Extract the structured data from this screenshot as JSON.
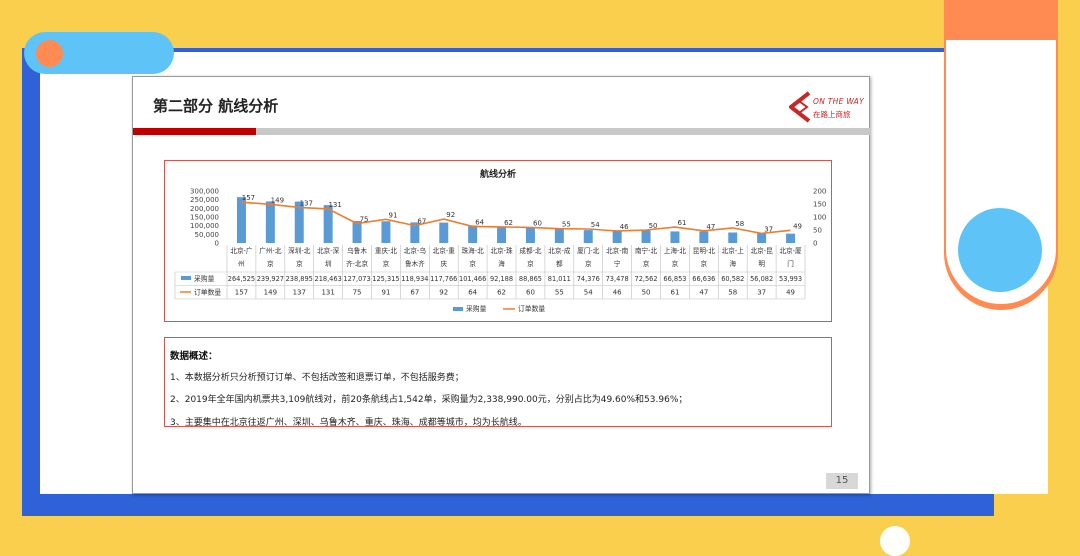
{
  "slide": {
    "title": "第二部分  航线分析",
    "logo_text": "ON THE WAY",
    "logo_subtext": "在路上商旅",
    "page_number": "15"
  },
  "summary": {
    "heading": "数据概述：",
    "lines": [
      "1、本数据分析只分析预订订单、不包括改签和退票订单，不包括服务费；",
      "2、2019年全年国内机票共3,109航线对，前20条航线占1,542单，采购量为2,338,990.00元，分别占比为49.60%和53.96%；",
      "3、主要集中在北京往返广州、深圳、乌鲁木齐、重庆、珠海、成都等城市，均为长航线。"
    ]
  },
  "colors": {
    "bar": "#5b9bd5",
    "line": "#ed7d31",
    "accent_red": "#c00000",
    "frame_blue": "#2f62d9",
    "background_yellow": "#f9cf4d",
    "decor_orange": "#ff8a52",
    "decor_cyan": "#5ec4f8"
  },
  "chart_data": {
    "type": "bar",
    "title": "航线分析",
    "categories": [
      [
        "北京-广",
        "州"
      ],
      [
        "广州-北",
        "京"
      ],
      [
        "深圳-北",
        "京"
      ],
      [
        "北京-深",
        "圳"
      ],
      [
        "乌鲁木",
        "齐-北京"
      ],
      [
        "重庆-北",
        "京"
      ],
      [
        "北京-乌",
        "鲁木齐"
      ],
      [
        "北京-重",
        "庆"
      ],
      [
        "珠海-北",
        "京"
      ],
      [
        "北京-珠",
        "海"
      ],
      [
        "成都-北",
        "京"
      ],
      [
        "北京-成",
        "都"
      ],
      [
        "厦门-北",
        "京"
      ],
      [
        "北京-南",
        "宁"
      ],
      [
        "南宁-北",
        "京"
      ],
      [
        "上海-北",
        "京"
      ],
      [
        "昆明-北",
        "京"
      ],
      [
        "北京-上",
        "海"
      ],
      [
        "北京-昆",
        "明"
      ],
      [
        "北京-厦",
        "门"
      ]
    ],
    "series": [
      {
        "name": "采购量",
        "type": "bar",
        "axis": "left",
        "values": [
          264525,
          239927,
          238895,
          218463,
          127073,
          125315,
          118934,
          117766,
          101466,
          92188,
          88865,
          81011,
          74376,
          73478,
          72562,
          66853,
          66636,
          60582,
          56082,
          53993
        ],
        "table_labels": [
          "264,525",
          "239,927",
          "238,895",
          "218,463",
          "127,073",
          "125,315",
          "118,934",
          "117,766",
          "101,466",
          "92,188",
          "",
          "88,865",
          "81,011",
          "74,376",
          "73,478",
          "72,562",
          "66,853",
          "66,636",
          "60,582",
          "56,082",
          "53,993"
        ]
      },
      {
        "name": "订单数量",
        "type": "line",
        "axis": "right",
        "values": [
          157,
          149,
          137,
          131,
          75,
          91,
          67,
          92,
          64,
          62,
          60,
          55,
          54,
          46,
          50,
          61,
          47,
          58,
          37,
          49
        ],
        "table_labels": [
          "157",
          "149",
          "137",
          "131",
          "75",
          "91",
          "67",
          "92",
          "64",
          "62",
          "60",
          "55",
          "54",
          "46",
          "50",
          "61",
          "47",
          "58",
          "37",
          "49"
        ]
      }
    ],
    "y_left_ticks": [
      "300,000",
      "250,000",
      "200,000",
      "150,000",
      "100,000",
      "50,000",
      "0"
    ],
    "y_left_range": [
      0,
      300000
    ],
    "y_right_ticks": [
      "200",
      "150",
      "100",
      "50",
      "0"
    ],
    "y_right_range": [
      0,
      200
    ],
    "legend_position": "bottom",
    "data_table": true
  }
}
